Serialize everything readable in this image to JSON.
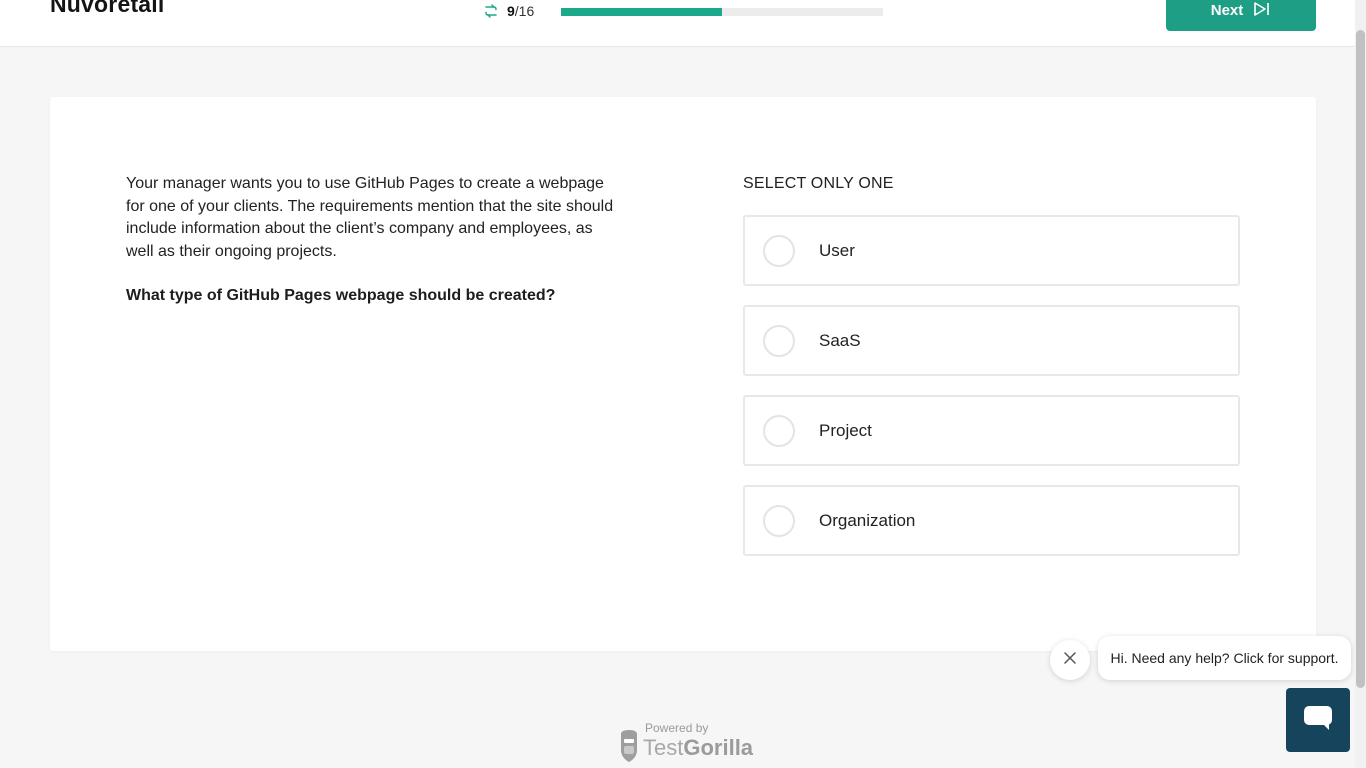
{
  "header": {
    "brand": "Nuvoretail",
    "progress": {
      "current": "9",
      "total": "/16",
      "fraction": 0.5
    },
    "next_label": "Next"
  },
  "question": {
    "scenario": "Your manager wants you to use GitHub Pages to create a webpage for one of your clients. The requirements mention that the site should include information about the client’s company and employees, as well as their ongoing projects.",
    "prompt": "What type of GitHub Pages webpage should be created?"
  },
  "answers": {
    "instruction": "SELECT ONLY ONE",
    "options": [
      "User",
      "SaaS",
      "Project",
      "Organization"
    ]
  },
  "support": {
    "message": "Hi. Need any help? Click for support."
  },
  "footer": {
    "powered_by": "Powered by",
    "logo_part1": "Test",
    "logo_part2": "Gorilla"
  },
  "colors": {
    "accent": "#1f9e86",
    "progress": "#1ba88b",
    "chat": "#17445d"
  }
}
